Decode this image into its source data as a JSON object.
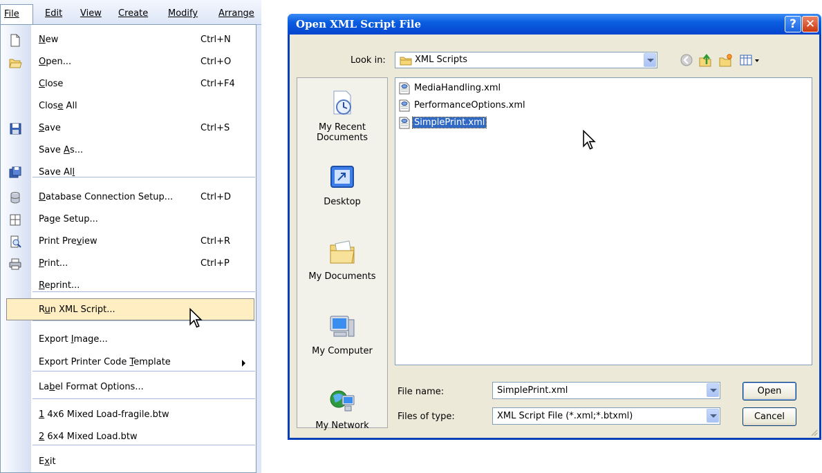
{
  "menubar": {
    "file": "File",
    "edit": "Edit",
    "view": "View",
    "create": "Create",
    "modify": "Modify",
    "arrange": "Arrange"
  },
  "file_menu": {
    "items": [
      {
        "pre": "",
        "u": "N",
        "post": "ew",
        "shortcut": "Ctrl+N",
        "icon": "new-document-icon"
      },
      {
        "pre": "",
        "u": "O",
        "post": "pen...",
        "shortcut": "Ctrl+O",
        "icon": "open-folder-icon"
      },
      {
        "pre": "",
        "u": "C",
        "post": "lose",
        "shortcut": "Ctrl+F4",
        "icon": ""
      },
      {
        "pre": "Clos",
        "u": "e",
        "post": " All",
        "shortcut": "",
        "icon": ""
      },
      {
        "pre": "",
        "u": "S",
        "post": "ave",
        "shortcut": "Ctrl+S",
        "icon": "save-disk-icon"
      },
      {
        "pre": "Save ",
        "u": "A",
        "post": "s...",
        "shortcut": "",
        "icon": ""
      },
      {
        "pre": "Save Al",
        "u": "l",
        "post": "",
        "shortcut": "",
        "icon": "save-all-icon"
      },
      {
        "pre": "",
        "u": "D",
        "post": "atabase Connection Setup...",
        "shortcut": "Ctrl+D",
        "icon": "database-icon"
      },
      {
        "pre": "Pa",
        "u": "g",
        "post": "e Setup...",
        "shortcut": "",
        "icon": "page-setup-icon"
      },
      {
        "pre": "Print Pre",
        "u": "v",
        "post": "iew",
        "shortcut": "Ctrl+R",
        "icon": "print-preview-icon"
      },
      {
        "pre": "",
        "u": "P",
        "post": "rint...",
        "shortcut": "Ctrl+P",
        "icon": "printer-icon"
      },
      {
        "pre": "",
        "u": "R",
        "post": "eprint...",
        "shortcut": "",
        "icon": ""
      },
      {
        "pre": "R",
        "u": "u",
        "post": "n XML Script...",
        "shortcut": "",
        "icon": ""
      },
      {
        "pre": "Export ",
        "u": "I",
        "post": "mage...",
        "shortcut": "",
        "icon": ""
      },
      {
        "pre": "Export Printer Code ",
        "u": "T",
        "post": "emplate",
        "shortcut": "",
        "icon": ""
      },
      {
        "pre": "La",
        "u": "b",
        "post": "el Format Options...",
        "shortcut": "",
        "icon": ""
      },
      {
        "pre": "",
        "u": "1",
        "post": " 4x6 Mixed Load-fragile.btw",
        "shortcut": "",
        "icon": ""
      },
      {
        "pre": "",
        "u": "2",
        "post": " 6x4 Mixed Load.btw",
        "shortcut": "",
        "icon": ""
      },
      {
        "pre": "E",
        "u": "x",
        "post": "it",
        "shortcut": "",
        "icon": ""
      }
    ]
  },
  "dialog": {
    "title": "Open XML Script File",
    "help_glyph": "?",
    "close_glyph": "✕",
    "look_in_label": "Look in:",
    "look_in_value": "XML Scripts",
    "places": [
      {
        "label_line1": "My Recent",
        "label_line2": "Documents"
      },
      {
        "label_line1": "Desktop",
        "label_line2": ""
      },
      {
        "label_line1": "My Documents",
        "label_line2": ""
      },
      {
        "label_line1": "My Computer",
        "label_line2": ""
      },
      {
        "label_line1": "My Network",
        "label_line2": ""
      }
    ],
    "files": [
      "MediaHandling.xml",
      "PerformanceOptions.xml",
      "SimplePrint.xml"
    ],
    "selected_file_index": 2,
    "file_name_label": "File name:",
    "file_name_value": "SimplePrint.xml",
    "files_of_type_label": "Files of type:",
    "files_of_type_value": "XML Script File (*.xml;*.btxml)",
    "open_button": "Open",
    "cancel_button": "Cancel"
  },
  "colors": {
    "titlebar": "#0a5ee0",
    "menu_highlight": "#ffeec2",
    "selection": "#316ac5"
  }
}
